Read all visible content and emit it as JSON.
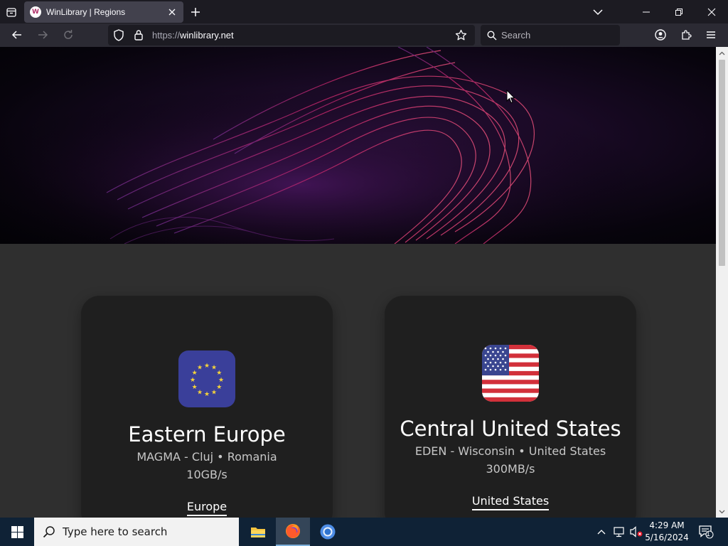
{
  "browser": {
    "tab_title": "WinLibrary | Regions",
    "url_protocol": "https://",
    "url_host": "winlibrary.net",
    "search_placeholder": "Search"
  },
  "cards": [
    {
      "region": "Eastern Europe",
      "location": "MAGMA - Cluj • Romania",
      "speed": "10GB/s",
      "link": "Europe",
      "flag": "eu-flag-icon"
    },
    {
      "region": "Central United States",
      "location": "EDEN - Wisconsin • United States",
      "speed": "300MB/s",
      "link": "United States",
      "flag": "us-flag-icon"
    }
  ],
  "taskbar": {
    "search_placeholder": "Type here to search",
    "time": "4:29 AM",
    "date": "5/16/2024",
    "notification_count": "1"
  },
  "colors": {
    "chrome_bg": "#1c1b22",
    "navbar_bg": "#2b2a33",
    "page_bg": "#2f2f2f",
    "card_bg": "#1f1f1f",
    "taskbar_bg": "#0f2236"
  }
}
